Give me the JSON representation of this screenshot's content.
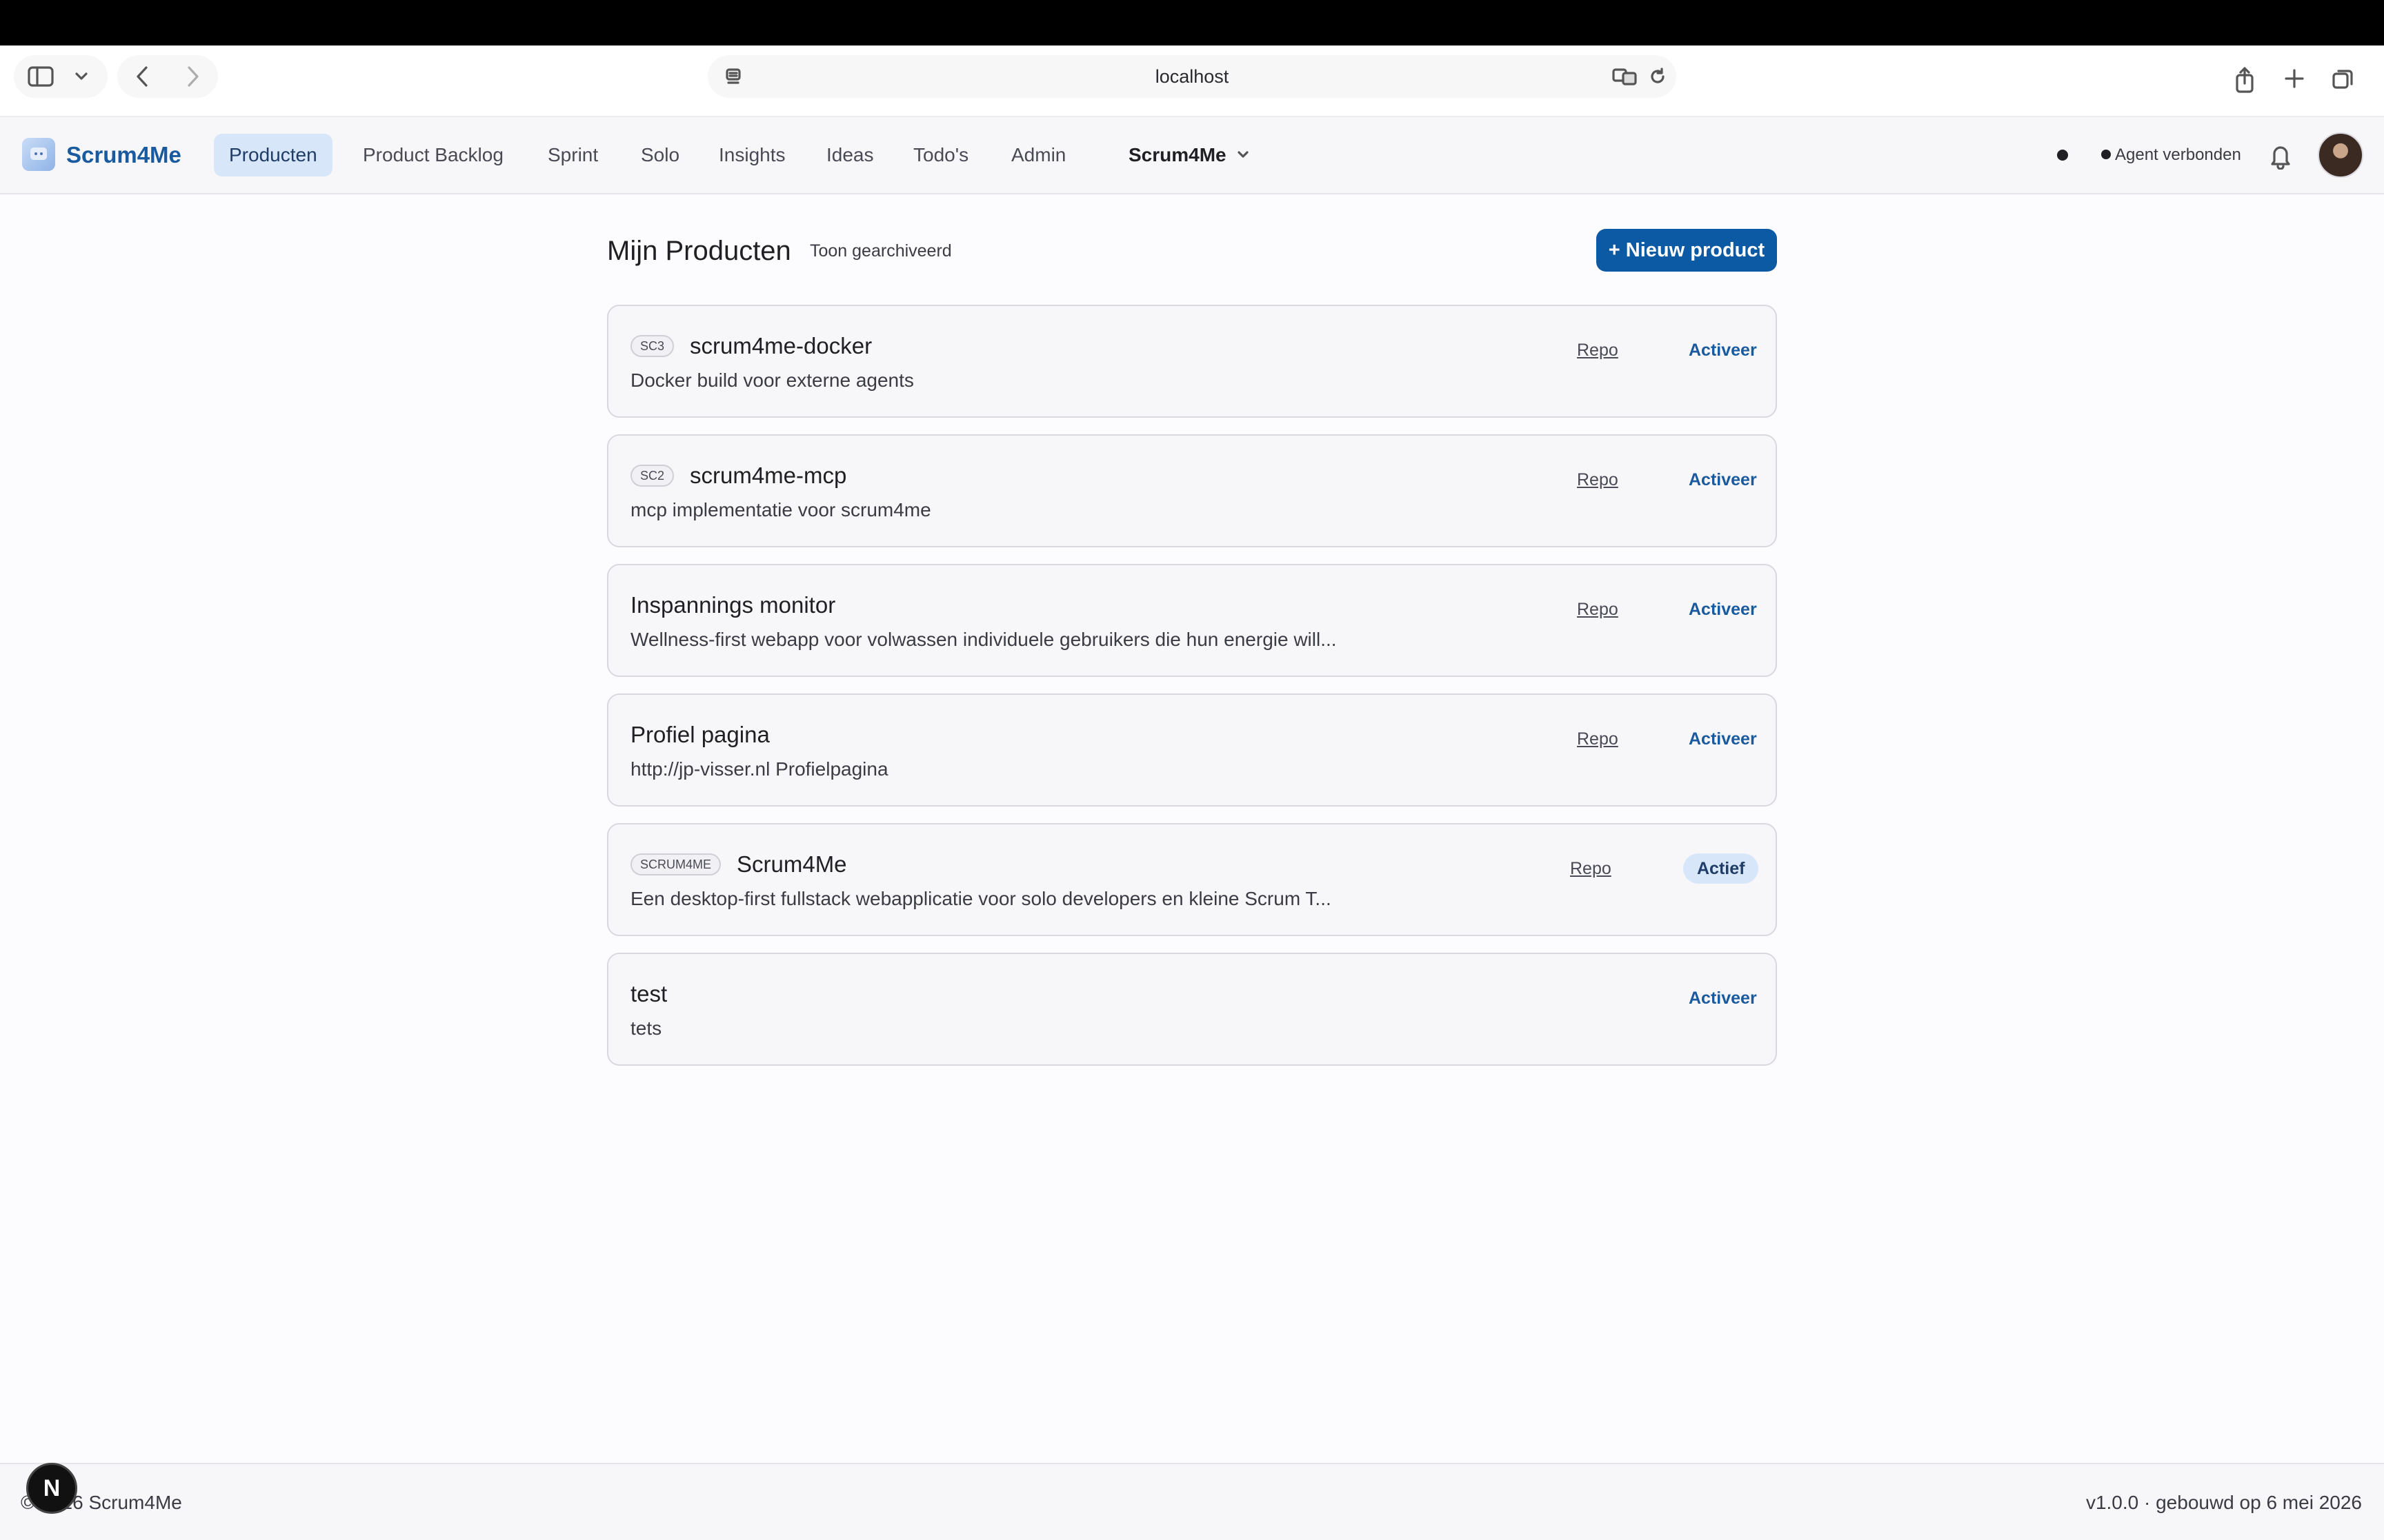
{
  "browser": {
    "url": "localhost"
  },
  "app": {
    "name": "Scrum4Me",
    "nav": [
      {
        "label": "Producten",
        "active": true
      },
      {
        "label": "Product Backlog",
        "active": false
      },
      {
        "label": "Sprint",
        "active": false
      },
      {
        "label": "Solo",
        "active": false
      },
      {
        "label": "Insights",
        "active": false
      },
      {
        "label": "Ideas",
        "active": false
      },
      {
        "label": "Todo's",
        "active": false
      },
      {
        "label": "Admin",
        "active": false
      }
    ],
    "product_select": "Scrum4Me",
    "agent_status": "Agent verbonden"
  },
  "page": {
    "title": "Mijn Producten",
    "show_archived": "Toon gearchiveerd",
    "new_product": "+ Nieuw product"
  },
  "products": [
    {
      "code": "SC3",
      "name": "scrum4me-docker",
      "description": "Docker build voor externe agents",
      "repo": "Repo",
      "action": "Activeer"
    },
    {
      "code": "SC2",
      "name": "scrum4me-mcp",
      "description": "mcp implementatie voor scrum4me",
      "repo": "Repo",
      "action": "Activeer"
    },
    {
      "code": "",
      "name": "Inspannings monitor",
      "description": "Wellness-first webapp voor volwassen individuele gebruikers die hun energie will...",
      "repo": "Repo",
      "action": "Activeer"
    },
    {
      "code": "",
      "name": "Profiel pagina",
      "description": "http://jp-visser.nl Profielpagina",
      "repo": "Repo",
      "action": "Activeer"
    },
    {
      "code": "SCRUM4ME",
      "name": "Scrum4Me",
      "description": "Een desktop-first fullstack webapplicatie voor solo developers en kleine Scrum T...",
      "repo": "Repo",
      "status": "Actief"
    },
    {
      "code": "",
      "name": "test",
      "description": "tets",
      "repo": "",
      "action": "Activeer"
    }
  ],
  "footer": {
    "copyright": "© 2026 Scrum4Me",
    "version": "v1.0.0 · gebouwd op 6 mei 2026"
  },
  "dev_badge": "N",
  "colors": {
    "accent": "#0c5aa3",
    "active_nav_bg": "#d8e6fa",
    "link": "#1a5a9e"
  }
}
